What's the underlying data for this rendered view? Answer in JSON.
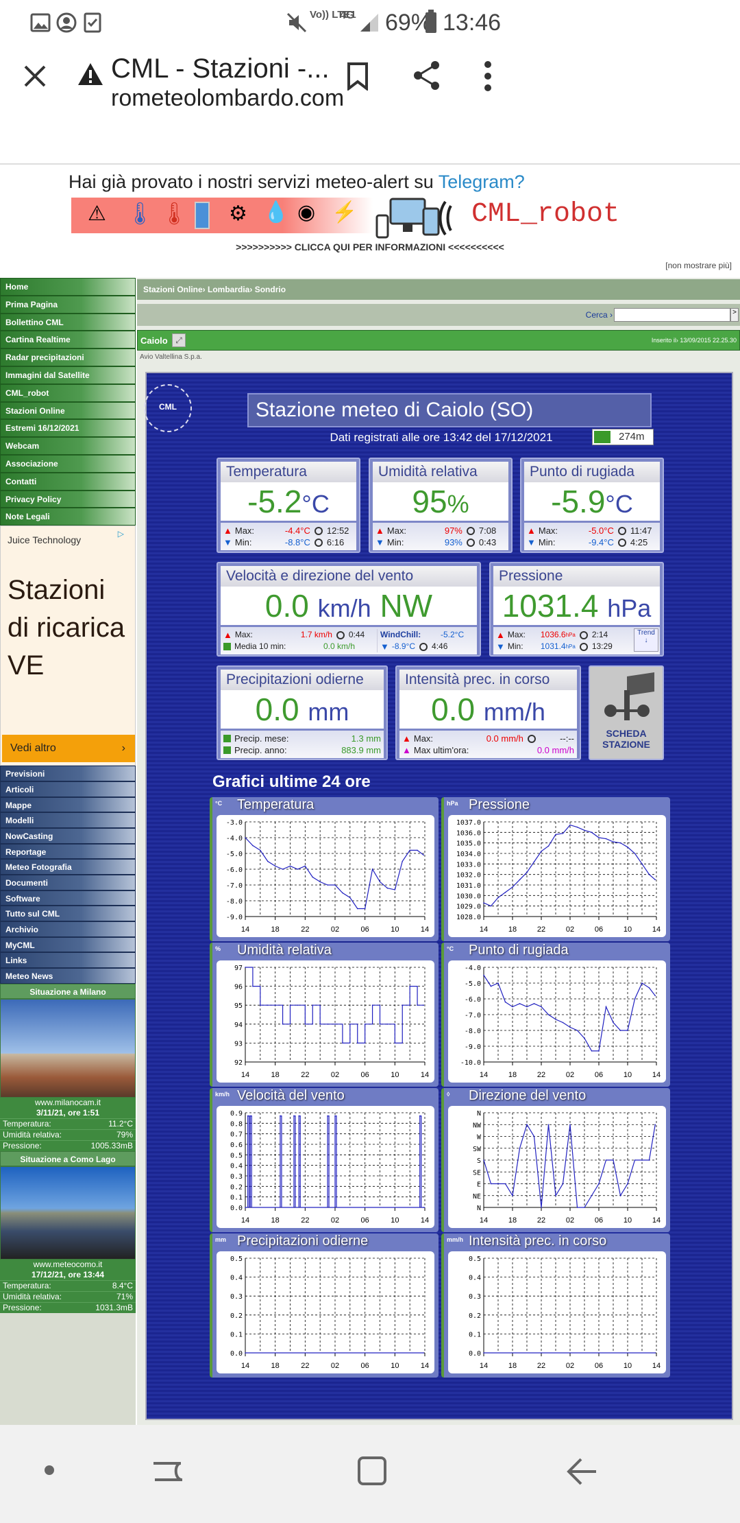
{
  "status_bar": {
    "volte": "Vo)) LTE1",
    "network": "4G",
    "battery": "69%",
    "time": "13:46"
  },
  "browser": {
    "title": "CML - Stazioni -...",
    "url": "rometeolombardo.com"
  },
  "banner": {
    "headline": "Hai già provato i nostri servizi meteo-alert su ",
    "headline_link": "Telegram?",
    "robot": "CML_robot",
    "cta": ">>>>>>>>>> CLICCA QUI PER INFORMAZIONI <<<<<<<<<<",
    "dismiss": "[non mostrare più]"
  },
  "sidebar": {
    "items": [
      "Home",
      "Prima Pagina",
      "Bollettino CML",
      "Cartina Realtime",
      "Radar precipitazioni",
      "Immagini dal Satellite",
      "CML_robot",
      "Stazioni Online",
      "Estremi 16/12/2021",
      "Webcam",
      "Associazione",
      "Contatti",
      "Privacy Policy",
      "Note Legali"
    ],
    "ad": {
      "advertiser": "Juice Technology",
      "headline": "Stazioni di ricarica VE",
      "button": "Vedi altro"
    },
    "items2": [
      "Previsioni",
      "Articoli",
      "Mappe",
      "Modelli",
      "NowCasting",
      "Reportage",
      "Meteo Fotografia",
      "Documenti",
      "Software",
      "Tutto sul CML",
      "Archivio",
      "MyCML",
      "Links",
      "Meteo News"
    ],
    "cams": [
      {
        "title": "Situazione a Milano",
        "site": "www.milanocam.it",
        "date": "3/11/21, ore 1:51",
        "rows": [
          [
            "Temperatura:",
            "11.2°C"
          ],
          [
            "Umidità relativa:",
            "79%"
          ],
          [
            "Pressione:",
            "1005.33mB"
          ]
        ]
      },
      {
        "title": "Situazione a Como Lago",
        "site": "www.meteocomo.it",
        "date": "17/12/21, ore 13:44",
        "rows": [
          [
            "Temperatura:",
            "8.4°C"
          ],
          [
            "Umidità relativa:",
            "71%"
          ],
          [
            "Pressione:",
            "1031.3mB"
          ]
        ]
      }
    ]
  },
  "main": {
    "breadcrumb": [
      "Stazioni Online",
      "Lombardia",
      "Sondrio"
    ],
    "search_label": "Cerca ›",
    "search_value": "",
    "search_go": ">",
    "station_bar": "Caiolo",
    "inserted": "Inserito il› 13/09/2015 22.25.30",
    "sponsor": "Avio Valtellina S.p.a.",
    "station_title": "Stazione meteo di Caiolo (SO)",
    "recorded": "Dati registrati alle ore 13:42 del 17/12/2021",
    "altitude": "274m",
    "temp": {
      "label": "Temperatura",
      "value": "-5.2",
      "unit": "°C",
      "max": "-4.4°C",
      "max_t": "12:52",
      "min": "-8.8°C",
      "min_t": "6:16"
    },
    "hum": {
      "label": "Umidità relativa",
      "value": "95",
      "unit": "%",
      "max": "97%",
      "max_t": "7:08",
      "min": "93%",
      "min_t": "0:43"
    },
    "dew": {
      "label": "Punto di rugiada",
      "value": "-5.9",
      "unit": "°C",
      "max": "-5.0°C",
      "max_t": "11:47",
      "min": "-9.4°C",
      "min_t": "4:25"
    },
    "wind": {
      "label": "Velocità e direzione del vento",
      "value": "0.0",
      "unit": "km/h",
      "dir": "NW",
      "max": "1.7 km/h",
      "max_t": "0:44",
      "avg_label": "Media 10 min:",
      "avg": "0.0 km/h",
      "wc_label": "WindChill:",
      "wc": "-5.2°C",
      "wc_min": "-8.9°C",
      "wc_min_t": "4:46"
    },
    "press": {
      "label": "Pressione",
      "value": "1031.4",
      "unit": "hPa",
      "max": "1036.6",
      "min": "1031.4",
      "u": "hPa",
      "max_t": "2:14",
      "min_t": "13:29",
      "trend": "Trend"
    },
    "rain": {
      "label": "Precipitazioni odierne",
      "value": "0.0",
      "unit": "mm",
      "month_label": "Precip. mese:",
      "month": "1.3 mm",
      "year_label": "Precip. anno:",
      "year": "883.9 mm"
    },
    "rate": {
      "label": "Intensità prec. in corso",
      "value": "0.0",
      "unit": "mm/h",
      "max": "0.0 mm/h",
      "max_t": "--:--",
      "lasthour_label": "Max ultim'ora:",
      "lasthour": "0.0 mm/h"
    },
    "scheda": "SCHEDA STAZIONE",
    "max_label": "Max:",
    "min_label": "Min:",
    "charts_title": "Grafici ultime 24 ore"
  },
  "chart_data": [
    {
      "type": "line",
      "title": "Temperatura",
      "unit": "°C",
      "ylim": [
        -9,
        -3
      ],
      "yticks": [
        "-3.0",
        "-4.0",
        "-5.0",
        "-6.0",
        "-7.0",
        "-8.0",
        "-9.0"
      ],
      "xticks": [
        "14",
        "18",
        "22",
        "02",
        "06",
        "10",
        "14"
      ],
      "grid": true,
      "x": [
        "14:00",
        "15:00",
        "16:00",
        "17:00",
        "18:00",
        "19:00",
        "20:00",
        "21:00",
        "22:00",
        "23:00",
        "00:00",
        "01:00",
        "02:00",
        "03:00",
        "04:00",
        "05:00",
        "06:00",
        "07:00",
        "08:00",
        "09:00",
        "10:00",
        "11:00",
        "12:00",
        "13:00",
        "13:50"
      ],
      "y": [
        -4.0,
        -4.5,
        -4.8,
        -5.5,
        -5.8,
        -6.0,
        -5.8,
        -6.0,
        -5.8,
        -6.5,
        -6.8,
        -7.0,
        -7.0,
        -7.5,
        -7.8,
        -8.5,
        -8.5,
        -6.0,
        -6.8,
        -7.2,
        -7.3,
        -5.5,
        -4.8,
        -4.8,
        -5.1
      ]
    },
    {
      "type": "line",
      "title": "Pressione",
      "unit": "hPa",
      "ylim": [
        1028,
        1037
      ],
      "yticks": [
        "1037.0",
        "1036.0",
        "1035.0",
        "1034.0",
        "1033.0",
        "1032.0",
        "1031.0",
        "1030.0",
        "1029.0",
        "1028.0"
      ],
      "xticks": [
        "14",
        "18",
        "22",
        "02",
        "06",
        "10",
        "14"
      ],
      "grid": true,
      "x": [
        "14:00",
        "15:00",
        "16:00",
        "17:00",
        "18:00",
        "19:00",
        "20:00",
        "21:00",
        "22:00",
        "23:00",
        "00:00",
        "01:00",
        "02:00",
        "03:00",
        "04:00",
        "05:00",
        "06:00",
        "07:00",
        "08:00",
        "09:00",
        "10:00",
        "11:00",
        "12:00",
        "13:00",
        "13:50"
      ],
      "y": [
        1029.3,
        1029.0,
        1029.8,
        1030.3,
        1030.8,
        1031.5,
        1032.2,
        1033.2,
        1034.2,
        1034.7,
        1035.8,
        1035.9,
        1036.7,
        1036.5,
        1036.2,
        1036.0,
        1035.5,
        1035.4,
        1035.1,
        1035.0,
        1034.6,
        1034.0,
        1033.0,
        1032.0,
        1031.5
      ]
    },
    {
      "type": "line",
      "title": "Umidità relativa",
      "unit": "%",
      "ylim": [
        92,
        97
      ],
      "yticks": [
        "97",
        "96",
        "95",
        "94",
        "93",
        "92"
      ],
      "xticks": [
        "14",
        "18",
        "22",
        "02",
        "06",
        "10",
        "14"
      ],
      "grid": true,
      "step": true,
      "x": [
        "14:00",
        "15:00",
        "16:00",
        "17:00",
        "18:00",
        "19:00",
        "20:00",
        "21:00",
        "22:00",
        "23:00",
        "00:00",
        "01:00",
        "02:00",
        "03:00",
        "04:00",
        "05:00",
        "06:00",
        "07:00",
        "08:00",
        "09:00",
        "10:00",
        "11:00",
        "12:00",
        "13:00",
        "13:50"
      ],
      "y": [
        97,
        96,
        95,
        95,
        95,
        94,
        95,
        95,
        94,
        95,
        94,
        94,
        94,
        93,
        94,
        93,
        94,
        95,
        94,
        94,
        93,
        95,
        96,
        95,
        95
      ]
    },
    {
      "type": "line",
      "title": "Punto di rugiada",
      "unit": "°C",
      "ylim": [
        -10,
        -4
      ],
      "yticks": [
        "-4.0",
        "-5.0",
        "-6.0",
        "-7.0",
        "-8.0",
        "-9.0",
        "-10.0"
      ],
      "xticks": [
        "14",
        "18",
        "22",
        "02",
        "06",
        "10",
        "14"
      ],
      "grid": true,
      "x": [
        "14:00",
        "15:00",
        "16:00",
        "17:00",
        "18:00",
        "19:00",
        "20:00",
        "21:00",
        "22:00",
        "23:00",
        "00:00",
        "01:00",
        "02:00",
        "03:00",
        "04:00",
        "05:00",
        "06:00",
        "07:00",
        "08:00",
        "09:00",
        "10:00",
        "11:00",
        "12:00",
        "13:00",
        "13:50"
      ],
      "y": [
        -4.5,
        -5.2,
        -5.0,
        -6.2,
        -6.5,
        -6.3,
        -6.5,
        -6.3,
        -6.5,
        -7.0,
        -7.3,
        -7.5,
        -7.8,
        -8.0,
        -8.5,
        -9.3,
        -9.3,
        -6.5,
        -7.5,
        -8.0,
        -8.0,
        -6.0,
        -5.0,
        -5.3,
        -5.8
      ]
    },
    {
      "type": "line",
      "title": "Velocità del vento",
      "unit": "km/h",
      "ylim": [
        0,
        0.9
      ],
      "yticks": [
        "0.9",
        "0.8",
        "0.7",
        "0.6",
        "0.5",
        "0.4",
        "0.3",
        "0.2",
        "0.1",
        "0.0"
      ],
      "xticks": [
        "14",
        "18",
        "22",
        "02",
        "06",
        "10",
        "14"
      ],
      "grid": true,
      "x": [
        "14:00",
        "14:20",
        "14:40",
        "18:40",
        "20:30",
        "21:10",
        "01:00",
        "02:00",
        "13:20",
        "13:50"
      ],
      "y": [
        0,
        0.87,
        0.87,
        0.87,
        0.87,
        0.87,
        0.87,
        0.87,
        0.87,
        0
      ],
      "spikes": true
    },
    {
      "type": "line",
      "title": "Direzione del vento",
      "unit": "◊",
      "ylim": [
        0,
        8
      ],
      "yticks": [
        "N",
        "NW",
        "W",
        "SW",
        "S",
        "SE",
        "E",
        "NE",
        "N"
      ],
      "xticks": [
        "14",
        "18",
        "22",
        "02",
        "06",
        "10",
        "14"
      ],
      "grid": true,
      "x": [
        "14:00",
        "15:00",
        "16:00",
        "17:00",
        "18:00",
        "19:00",
        "20:00",
        "21:00",
        "22:00",
        "23:00",
        "00:00",
        "01:00",
        "02:00",
        "03:00",
        "04:00",
        "05:00",
        "06:00",
        "07:00",
        "08:00",
        "09:00",
        "10:00",
        "11:00",
        "12:00",
        "13:00",
        "13:50"
      ],
      "y": [
        "S",
        "E",
        "E",
        "E",
        "NE",
        "SW",
        "NW",
        "W",
        "N",
        "NW",
        "NE",
        "E",
        "NW",
        "N",
        "N",
        "NE",
        "E",
        "S",
        "S",
        "NE",
        "E",
        "S",
        "S",
        "S",
        "NW"
      ]
    },
    {
      "type": "line",
      "title": "Precipitazioni odierne",
      "unit": "mm",
      "ylim": [
        0,
        0.5
      ],
      "yticks": [
        "0.5",
        "0.4",
        "0.3",
        "0.2",
        "0.1",
        "0.0"
      ],
      "xticks": [
        "14",
        "18",
        "22",
        "02",
        "06",
        "10",
        "14"
      ],
      "grid": true,
      "x": [
        "14:00",
        "13:50"
      ],
      "y": [
        0,
        0
      ]
    },
    {
      "type": "line",
      "title": "Intensità prec. in corso",
      "unit": "mm/h",
      "ylim": [
        0,
        0.5
      ],
      "yticks": [
        "0.5",
        "0.4",
        "0.3",
        "0.2",
        "0.1",
        "0.0"
      ],
      "xticks": [
        "14",
        "18",
        "22",
        "02",
        "06",
        "10",
        "14"
      ],
      "grid": true,
      "x": [
        "14:00",
        "13:50"
      ],
      "y": [
        0,
        0
      ]
    }
  ],
  "colors": {
    "sidebar_green": "#3f8a3f",
    "sidebar_blue": "#2c4470",
    "panel_blue": "#1b2590",
    "value_green": "#3f9a2f",
    "unit_blue": "#3a48a8",
    "max_red": "#ee0000",
    "min_blue": "#1560d0",
    "series": "#2020c0"
  }
}
